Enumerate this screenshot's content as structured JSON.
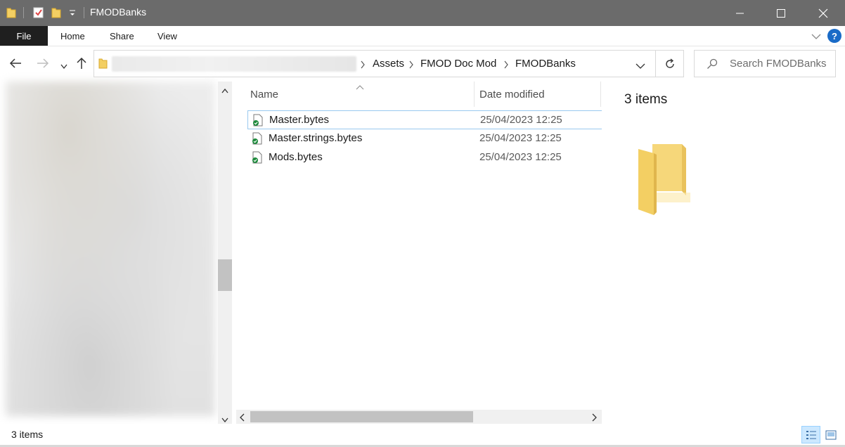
{
  "window": {
    "title": "FMODBanks",
    "quick_access_dropdown": "▾"
  },
  "ribbon": {
    "tabs": [
      {
        "label": "File"
      },
      {
        "label": "Home"
      },
      {
        "label": "Share"
      },
      {
        "label": "View"
      }
    ],
    "help_label": "?"
  },
  "address": {
    "breadcrumbs": [
      "Assets",
      "FMOD Doc Mod",
      "FMODBanks"
    ],
    "search_placeholder": "Search FMODBanks"
  },
  "file_list": {
    "columns": [
      "Name",
      "Date modified"
    ],
    "items": [
      {
        "name": "Master.bytes",
        "date_modified": "25/04/2023 12:25",
        "sync_status": "synced"
      },
      {
        "name": "Master.strings.bytes",
        "date_modified": "25/04/2023 12:25",
        "sync_status": "synced"
      },
      {
        "name": "Mods.bytes",
        "date_modified": "25/04/2023 12:25",
        "sync_status": "synced"
      }
    ]
  },
  "details_pane": {
    "item_count_label": "3 items",
    "preview_icon": "folder-icon"
  },
  "status_bar": {
    "item_count": "3 items",
    "active_view": "details"
  },
  "colors": {
    "titlebar": "#6b6b6b",
    "file_tab": "#1f1f1f",
    "help_blue": "#1a6bc7",
    "sync_green": "#1e8a3c",
    "folder_yellow": "#f3cf63",
    "selection_border": "#99c9ef"
  }
}
